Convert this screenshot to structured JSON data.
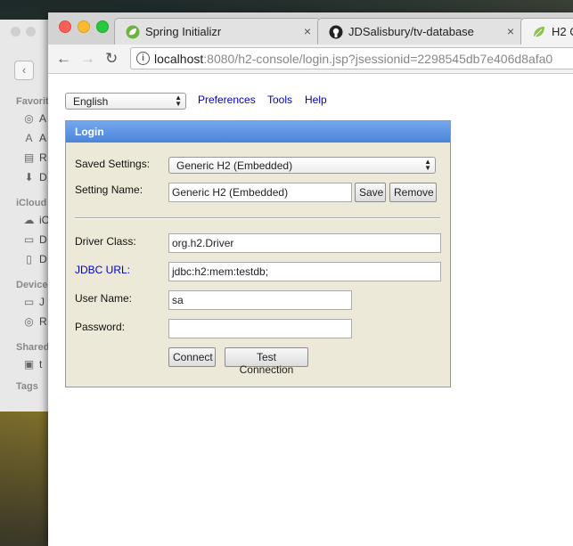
{
  "finder": {
    "sections": [
      "Favorit",
      "iCloud",
      "Device",
      "Shared",
      "Tags"
    ],
    "items": [
      "A",
      "A",
      "R",
      "D",
      "iC",
      "D",
      "D",
      "J",
      "R",
      "t"
    ]
  },
  "browser": {
    "tabs": [
      {
        "title": "Spring Initializr",
        "close": "×",
        "icon": "spring-leaf-icon"
      },
      {
        "title": "JDSalisbury/tv-database",
        "close": "×",
        "icon": "github-icon"
      },
      {
        "title": "H2 C",
        "icon": "h2-leaf-icon"
      }
    ],
    "url": {
      "host": "localhost",
      "rest": ":8080/h2-console/login.jsp?jsessionid=2298545db7e406d8afa0"
    }
  },
  "page": {
    "language": "English",
    "links": [
      "Preferences",
      "Tools",
      "Help"
    ],
    "login": {
      "title": "Login",
      "saved_settings_label": "Saved Settings:",
      "saved_settings_value": "Generic H2 (Embedded)",
      "setting_name_label": "Setting Name:",
      "setting_name_value": "Generic H2 (Embedded)",
      "save_button": "Save",
      "remove_button": "Remove",
      "driver_class_label": "Driver Class:",
      "driver_class_value": "org.h2.Driver",
      "jdbc_url_label": "JDBC URL:",
      "jdbc_url_value": "jdbc:h2:mem:testdb;",
      "user_name_label": "User Name:",
      "user_name_value": "sa",
      "password_label": "Password:",
      "password_value": "",
      "connect_button": "Connect",
      "test_connection_button": "Test Connection"
    }
  },
  "colors": {
    "login_header": "#4b84d9",
    "login_panel": "#ece9d8",
    "link": "#0000cc"
  }
}
